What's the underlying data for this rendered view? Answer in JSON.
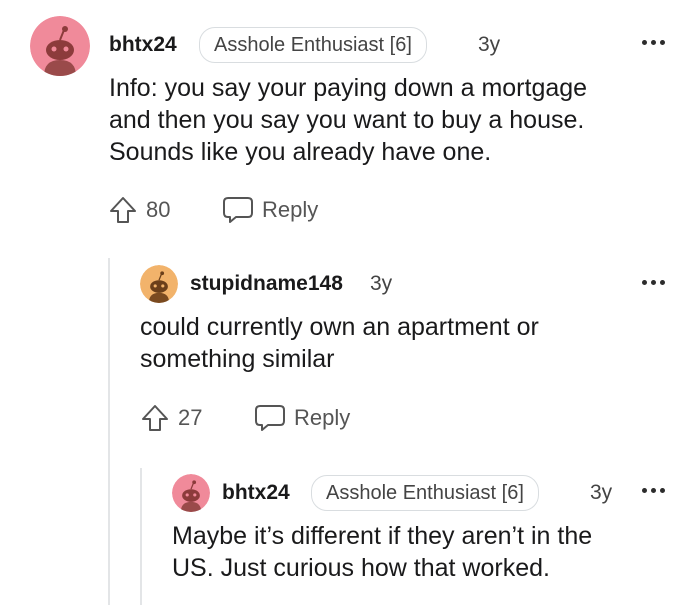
{
  "comments": [
    {
      "username": "bhtx24",
      "flair": "Asshole Enthusiast [6]",
      "age": "3y",
      "body_lines": [
        "Info: you say your paying down a mortgage",
        "and then you say you want to buy a house.",
        "Sounds like you already have one."
      ],
      "votes": "80",
      "reply_label": "Reply",
      "avatar_color": "#f08a9a"
    },
    {
      "username": "stupidname148",
      "age": "3y",
      "body_lines": [
        "could currently own an apartment or",
        "something similar"
      ],
      "votes": "27",
      "reply_label": "Reply",
      "avatar_color": "#f2b36b"
    },
    {
      "username": "bhtx24",
      "flair": "Asshole Enthusiast [6]",
      "age": "3y",
      "body_lines": [
        "Maybe it’s different if they aren’t in the",
        "US. Just curious how that worked."
      ],
      "avatar_color": "#f08a9a"
    }
  ],
  "icons": {
    "upvote": "upvote-arrow-icon",
    "reply": "speech-bubble-icon",
    "more": "more-options-icon",
    "avatar": "snoo-avatar-icon"
  }
}
